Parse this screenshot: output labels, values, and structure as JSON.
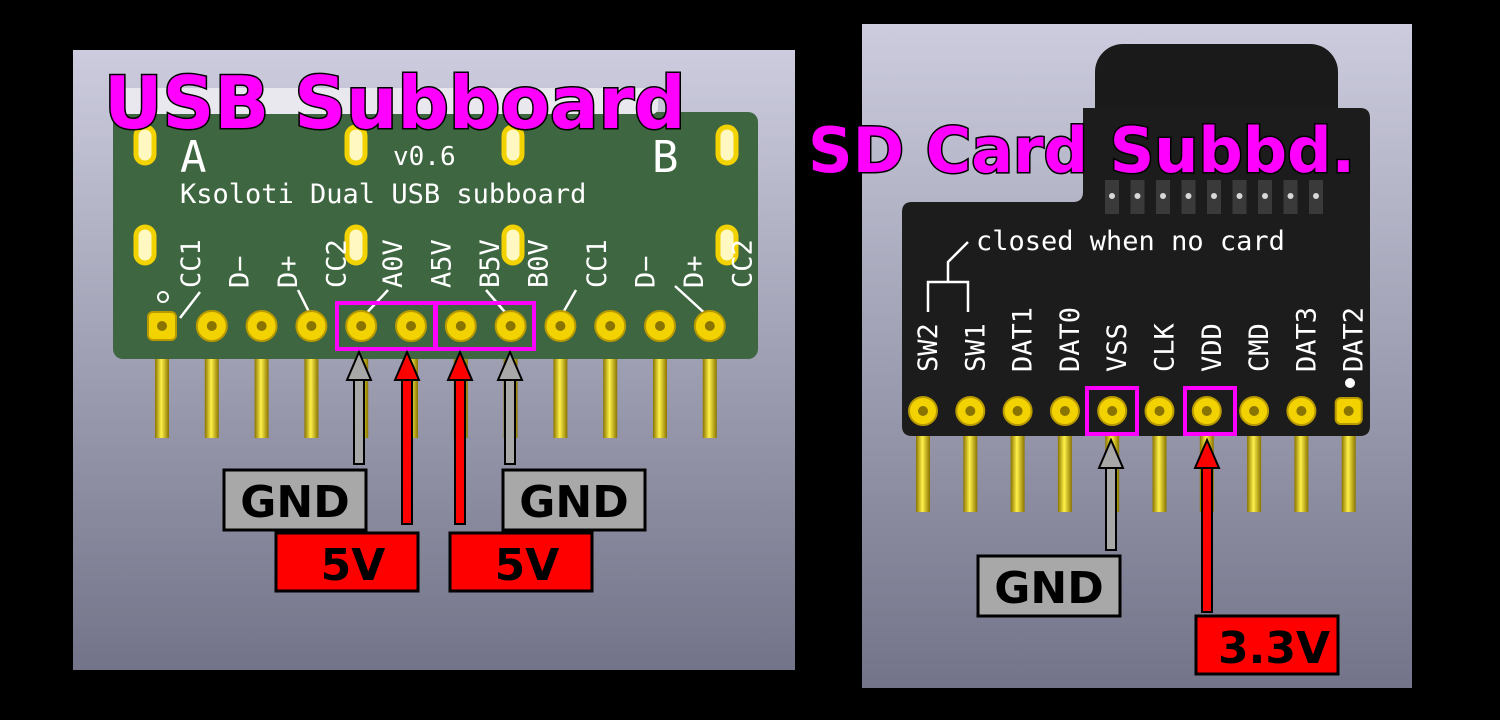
{
  "colors": {
    "background": "#000000",
    "panel_top": "#ccccde",
    "panel_bottom": "#737389",
    "pcb": "#3e6640",
    "sd_pcb": "#1c1c1c",
    "title": "#ff00ff",
    "highlight": "#ff00ff",
    "gnd_box": "#a8a8a8",
    "power_box": "#ff0000",
    "pin": "#f2d200"
  },
  "usb": {
    "title": "USB Subboard",
    "port_a": "A",
    "port_b": "B",
    "version": "v0.6",
    "name": "Ksoloti Dual USB subboard",
    "pins": [
      "CC1",
      "D−",
      "D+",
      "CC2",
      "A0V",
      "A5V",
      "B5V",
      "B0V",
      "CC1",
      "D−",
      "D+",
      "CC2"
    ],
    "gnd_left": "GND",
    "gnd_right": "GND",
    "v5_left": "5V",
    "v5_right": "5V"
  },
  "sd": {
    "title": "SD Card Subbd.",
    "note": "closed when no card",
    "pins": [
      "SW2",
      "SW1",
      "DAT1",
      "DAT0",
      "VSS",
      "CLK",
      "VDD",
      "CMD",
      "DAT3",
      "DAT2"
    ],
    "gnd": "GND",
    "v33": "3.3V"
  }
}
